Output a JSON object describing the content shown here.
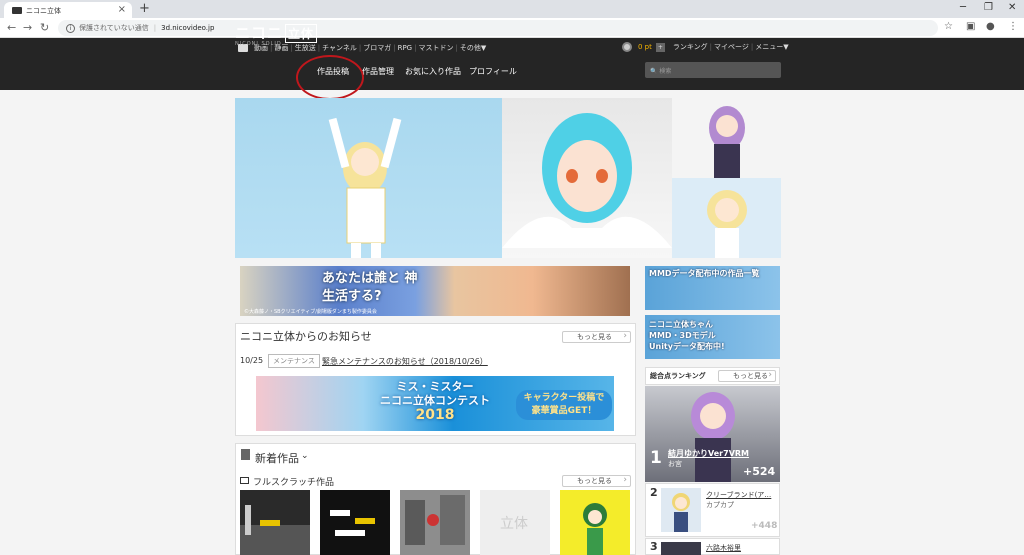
{
  "browser": {
    "tab_title": "ニコニ立体",
    "tab_close": "×",
    "new_tab": "+",
    "address_security": "保護されていない通信",
    "address_url": "3d.nicovideo.jp",
    "win_min": "─",
    "win_max": "❐",
    "win_close": "✕"
  },
  "site": {
    "nav_items": [
      "動画",
      "静画",
      "生放送",
      "チャンネル",
      "ブロマガ",
      "RPG",
      "マストドン",
      "その他▼"
    ],
    "points": "0 pt",
    "right_items": [
      "ランキング",
      "マイページ",
      "メニュー▼"
    ],
    "logo": "ニコニ",
    "logo_box": "立体",
    "logo_sub": "NICONI SOLID",
    "main_nav": [
      "作品投稿",
      "作品管理",
      "お気に入り作品",
      "プロフィール"
    ],
    "search_placeholder": "検索"
  },
  "ads": {
    "main_ad": "あなたは誰と 神生活する?",
    "main_ad_credit": "©大森藤ノ・SBクリエイティブ/劇場版ダンまち製作委員会",
    "right1": "MMDデータ配布中の作品一覧",
    "right2": "ニコニ立体ちゃん MMD・3Dモデル Unityデータ配布中!"
  },
  "news": {
    "title": "ニコニ立体からのお知らせ",
    "more": "もっと見る",
    "date": "10/25",
    "tag": "メンテナンス",
    "link": "緊急メンテナンスのお知らせ（2018/10/26）"
  },
  "contest": {
    "line1": "ミス・ミスター",
    "line2": "ニコニ立体コンテスト",
    "line3": "2018",
    "badge1": "キャラクター投稿で",
    "badge2": "豪華賞品GET！"
  },
  "new_works": {
    "title": "新着作品",
    "chevron": "⌄",
    "scratch_title": "フルスクラッチ作品",
    "more": "もっと見る"
  },
  "ranking": {
    "title": "総合点ランキング",
    "more": "もっと見る",
    "r1_num": "1",
    "r1_name": "結月ゆかりVer7VRM",
    "r1_author": "お宮",
    "r1_score": "+524",
    "r2_num": "2",
    "r2_name": "クリーブランド(ア…",
    "r2_author": "カプカプ",
    "r2_score": "+448",
    "r3_num": "3",
    "r3_name": "六路木裕里"
  },
  "colors": {
    "header_bg": "#252525",
    "annotation_circle": "#c0171c",
    "points_accent": "#f5b400"
  }
}
